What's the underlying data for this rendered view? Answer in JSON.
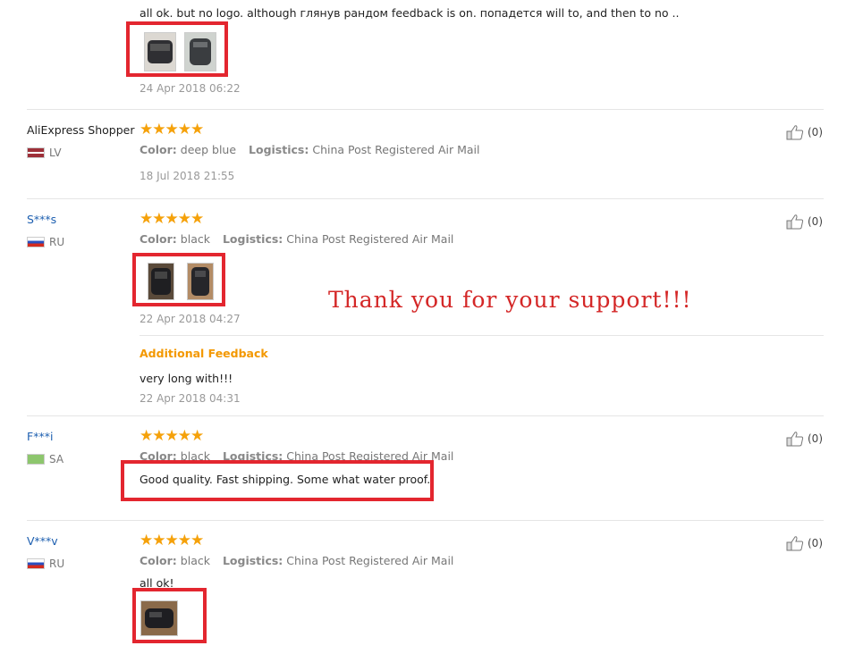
{
  "reviews": [
    {
      "text": "all ok. but no logo. although глянув рандом feedback is on. попадется will to, and then to no ..",
      "date": "24 Apr 2018 06:22"
    },
    {
      "user": "AliExpress Shopper",
      "country": "LV",
      "stars": "★★★★★",
      "color_label": "Color:",
      "color_value": "deep blue",
      "logistics_label": "Logistics:",
      "logistics_value": "China Post Registered Air Mail",
      "date": "18 Jul 2018 21:55",
      "helpful": "(0)"
    },
    {
      "user": "S***s",
      "country": "RU",
      "stars": "★★★★★",
      "color_label": "Color:",
      "color_value": "black",
      "logistics_label": "Logistics:",
      "logistics_value": "China Post Registered Air Mail",
      "date": "22 Apr 2018 04:27",
      "helpful": "(0)",
      "additional_label": "Additional Feedback",
      "additional_text": "very long with!!!",
      "additional_date": "22 Apr 2018 04:31"
    },
    {
      "user": "F***i",
      "country": "SA",
      "stars": "★★★★★",
      "color_label": "Color:",
      "color_value": "black",
      "logistics_label": "Logistics:",
      "logistics_value": "China Post Registered Air Mail",
      "text": "Good quality. Fast shipping. Some what water proof.",
      "helpful": "(0)"
    },
    {
      "user": "V***v",
      "country": "RU",
      "stars": "★★★★★",
      "color_label": "Color:",
      "color_value": "black",
      "logistics_label": "Logistics:",
      "logistics_value": "China Post Registered Air Mail",
      "text": "all ok!",
      "helpful": "(0)"
    }
  ],
  "overlay_text": "Thank you for your support!!!",
  "colors": {
    "star": "#f5a10a",
    "link": "#1d5fb0",
    "highlight": "#e3262f",
    "additional": "#f39800"
  }
}
